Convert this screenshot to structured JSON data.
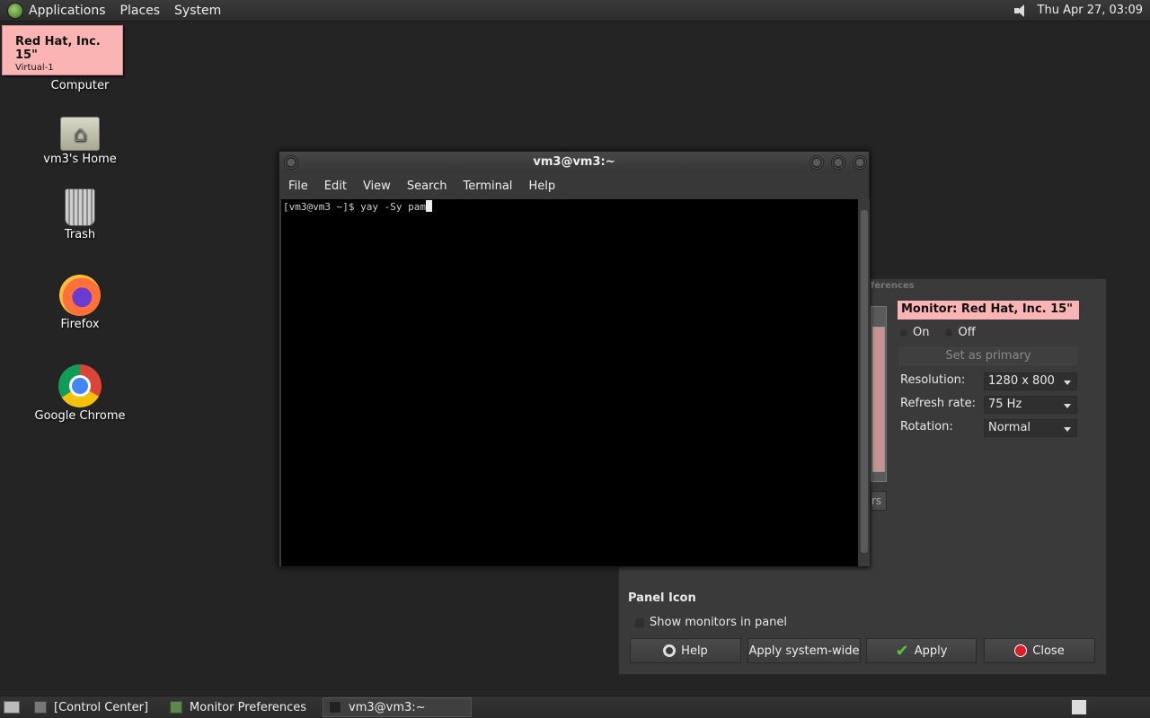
{
  "top_panel": {
    "menus": [
      "Applications",
      "Places",
      "System"
    ],
    "clock": "Thu Apr 27, 03:09"
  },
  "monitor_popup": {
    "title": "Red Hat, Inc. 15\"",
    "subtitle": "Virtual-1"
  },
  "desktop": {
    "icons": [
      {
        "label": "Computer",
        "icon": "computer-icon"
      },
      {
        "label": "vm3's Home",
        "icon": "home-folder-icon"
      },
      {
        "label": "Trash",
        "icon": "trash-icon"
      },
      {
        "label": "Firefox",
        "icon": "firefox-icon"
      },
      {
        "label": "Google Chrome",
        "icon": "chrome-icon"
      }
    ]
  },
  "terminal": {
    "title": "vm3@vm3:~",
    "menus": [
      "File",
      "Edit",
      "View",
      "Search",
      "Terminal",
      "Help"
    ],
    "prompt_line": "[vm3@vm3 ~]$ yay -Sy pam"
  },
  "monitor_prefs": {
    "title_fragment": "ferences",
    "detect_fragment": "rs",
    "monitor_heading": "Monitor: Red Hat, Inc. 15\"",
    "on_label": "On",
    "off_label": "Off",
    "set_primary_label": "Set as primary",
    "resolution_label": "Resolution:",
    "resolution_value": "1280 x 800",
    "refresh_label": "Refresh rate:",
    "refresh_value": "75 Hz",
    "rotation_label": "Rotation:",
    "rotation_value": "Normal",
    "panel_icon_heading": "Panel Icon",
    "show_monitors_label": "Show monitors in panel",
    "buttons": {
      "help": "Help",
      "apply_system_wide": "Apply system-wide",
      "apply": "Apply",
      "close": "Close"
    }
  },
  "taskbar": {
    "tasks": [
      "[Control Center]",
      "Monitor Preferences",
      "vm3@vm3:~"
    ]
  }
}
